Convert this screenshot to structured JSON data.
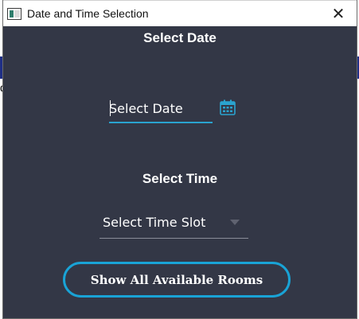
{
  "window": {
    "title": "Date and Time Selection",
    "close_symbol": "✕"
  },
  "date_section": {
    "heading": "Select Date",
    "input_placeholder": "Select Date",
    "calendar_icon": "calendar-icon"
  },
  "time_section": {
    "heading": "Select Time",
    "select_value": "Select Time Slot",
    "dropdown_icon": "dropdown-arrow-icon"
  },
  "actions": {
    "show_rooms_label": "Show All Available Rooms"
  },
  "colors": {
    "window_background": "#333746",
    "accent": "#19a3d6",
    "text": "#ffffff",
    "background_app_band": "#1f2f86"
  }
}
